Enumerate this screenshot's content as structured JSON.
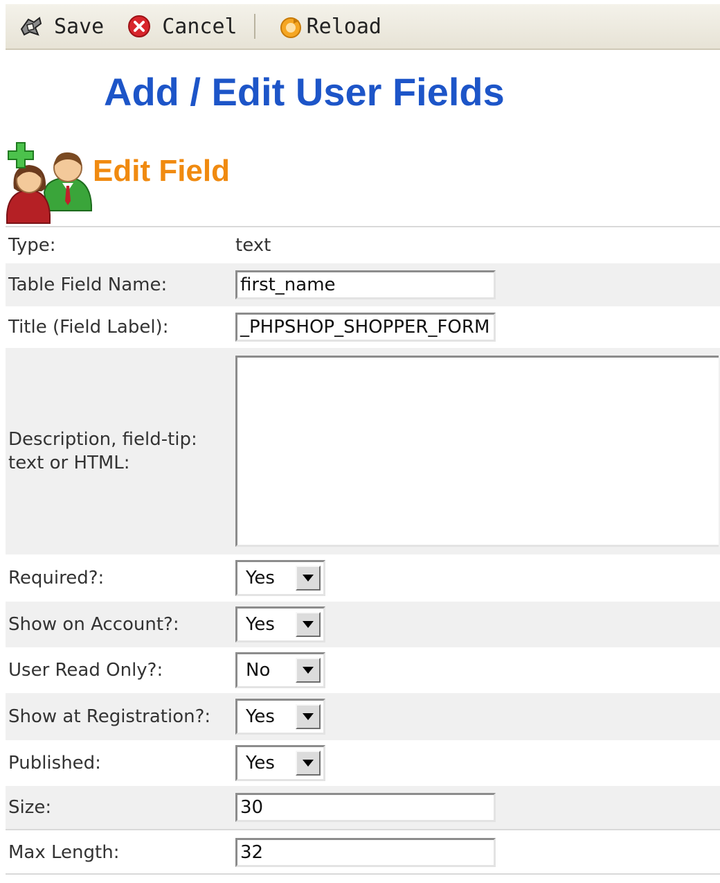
{
  "toolbar": {
    "save_label": "Save",
    "save_icon": "save-icon",
    "cancel_label": "Cancel",
    "cancel_icon": "cancel-icon",
    "reload_label": "Reload",
    "reload_icon": "reload-icon"
  },
  "page_title": "Add / Edit User Fields",
  "section": {
    "title": "Edit Field",
    "icon": "users-add-icon"
  },
  "form": {
    "type": {
      "label": "Type:",
      "value": "text"
    },
    "table_field_name": {
      "label": "Table Field Name:",
      "value": "first_name"
    },
    "title": {
      "label": "Title (Field Label):",
      "value": "_PHPSHOP_SHOPPER_FORM"
    },
    "description": {
      "label_line1": "Description, field-tip:",
      "label_line2": "text or HTML:",
      "value": ""
    },
    "required": {
      "label": "Required?:",
      "value": "Yes"
    },
    "show_on_account": {
      "label": "Show on Account?:",
      "value": "Yes"
    },
    "user_read_only": {
      "label": "User Read Only?:",
      "value": "No"
    },
    "show_at_registration": {
      "label": "Show at Registration?:",
      "value": "Yes"
    },
    "published": {
      "label": "Published:",
      "value": "Yes"
    },
    "size": {
      "label": "Size:",
      "value": "30"
    },
    "max_length": {
      "label": "Max Length:",
      "value": "32"
    }
  },
  "colors": {
    "page_title": "#1d55c8",
    "section_title": "#f08a10",
    "row_alt_bg": "#f0f0f0"
  }
}
